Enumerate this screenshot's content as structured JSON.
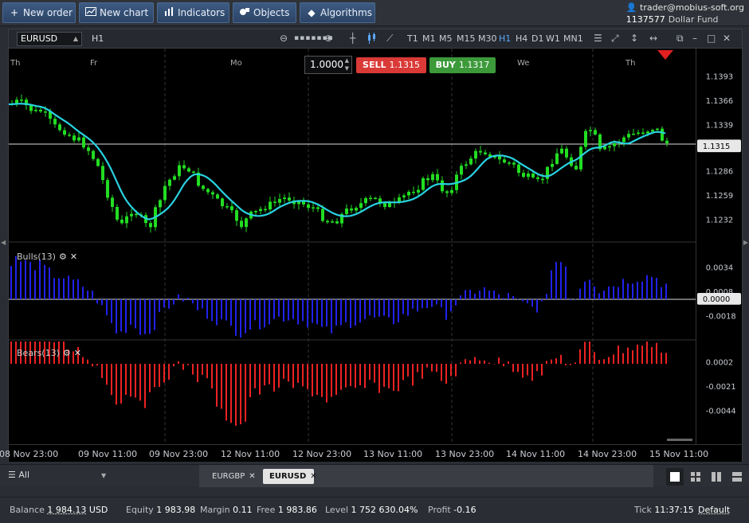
{
  "toolbar": {
    "new_order": "New order",
    "new_chart": "New chart",
    "indicators": "Indicators",
    "objects": "Objects",
    "algorithms": "Algorithms"
  },
  "account": {
    "email": "trader@mobius-soft.org",
    "number": "1137577",
    "fund": "Dollar Fund"
  },
  "chart": {
    "symbol": "EURUSD",
    "timeframe": "H1",
    "timeframes": [
      "T1",
      "M1",
      "M5",
      "M15",
      "M30",
      "H1",
      "H4",
      "D1",
      "W1",
      "MN1"
    ],
    "active_timeframe": "H1",
    "lot": "1.0000",
    "sell_label": "SELL",
    "sell_price": "1.1315",
    "buy_label": "BUY",
    "buy_price": "1.1317",
    "current_price": "1.1315",
    "day_labels": [
      "Th",
      "Fr",
      "Mo",
      "We",
      "Th"
    ],
    "price_ticks": [
      "1.1393",
      "1.1366",
      "1.1339",
      "1.1286",
      "1.1259",
      "1.1232"
    ],
    "bulls_label": "Bulls(13)",
    "bulls_ticks": [
      "0.0034",
      "0.0008",
      "-0.0018"
    ],
    "bulls_zero": "0.0000",
    "bears_label": "Bears(13)",
    "bears_ticks": [
      "0.0002",
      "-0.0021",
      "-0.0044"
    ],
    "time_labels": [
      "08 Nov 23:00",
      "09 Nov 11:00",
      "09 Nov 23:00",
      "12 Nov 11:00",
      "12 Nov 23:00",
      "13 Nov 11:00",
      "13 Nov 23:00",
      "14 Nov 11:00",
      "14 Nov 23:00",
      "15 Nov 11:00"
    ],
    "colors": {
      "bull_candle": "#22dd22",
      "ma": "#29d2e0",
      "bulls": "#2222ee",
      "bears": "#ee2222",
      "sell": "#d93a37",
      "buy": "#3c9a3a"
    }
  },
  "tabs": {
    "filter": "All",
    "items": [
      "EURGBP",
      "EURUSD"
    ],
    "active": "EURUSD"
  },
  "status": {
    "balance_label": "Balance",
    "balance_value": "1 984.13",
    "balance_currency": "USD",
    "equity_label": "Equity",
    "equity_value": "1 983.98",
    "margin_label": "Margin",
    "margin_value": "0.11",
    "free_label": "Free",
    "free_value": "1 983.86",
    "level_label": "Level",
    "level_value": "1 752 630.04%",
    "profit_label": "Profit",
    "profit_value": "-0.16",
    "tick_label": "Tick",
    "tick_time": "11:37:15",
    "tick_mode": "Default"
  }
}
